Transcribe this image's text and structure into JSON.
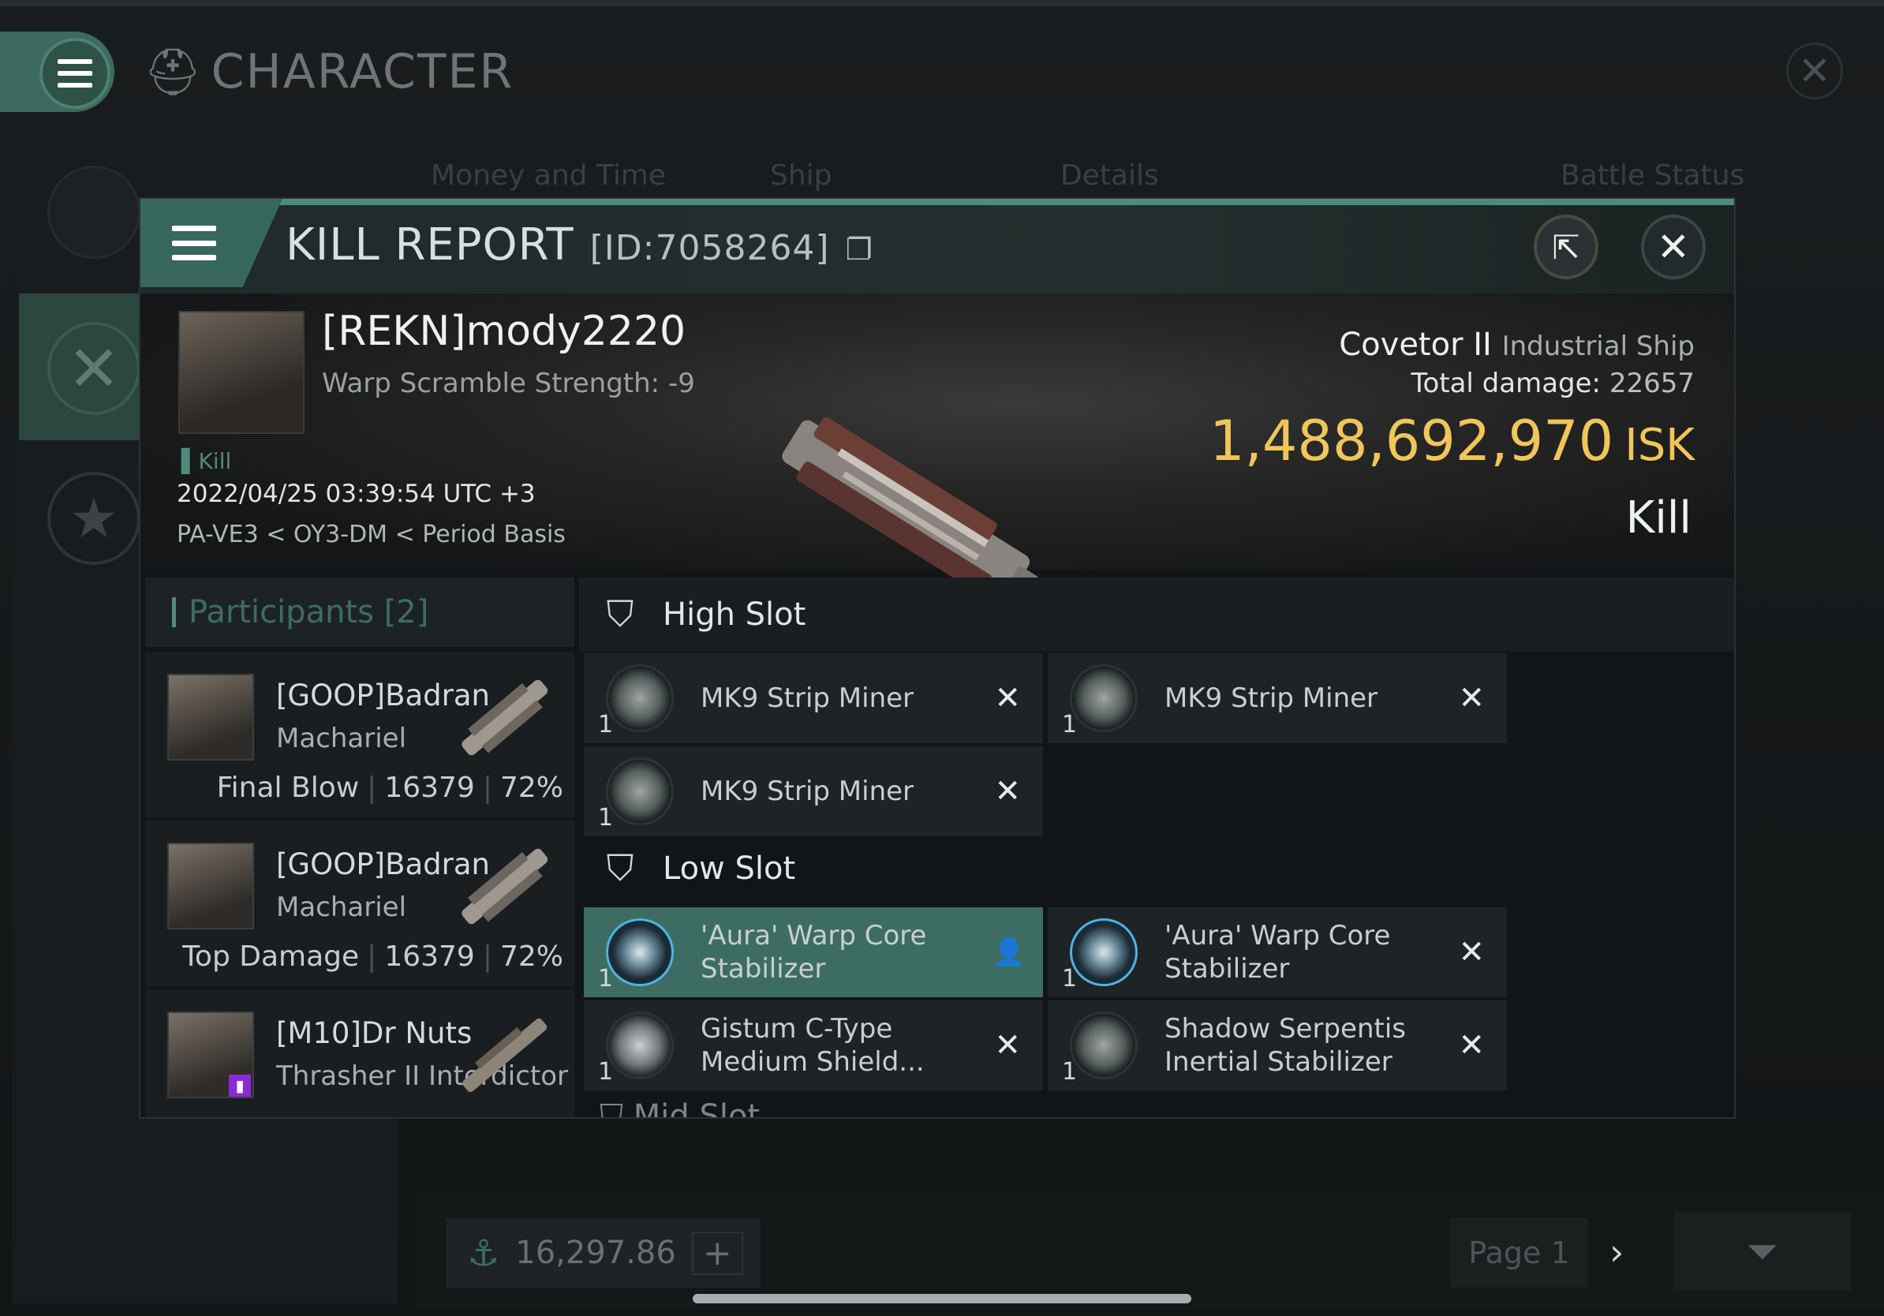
{
  "background": {
    "window_title": "CHARACTER",
    "tabs": [
      "Money and Time",
      "Ship",
      "Details",
      "Battle Status"
    ],
    "wallet_value": "16,297.86",
    "page_label": "Page 1"
  },
  "kill_report": {
    "title": "KILL REPORT",
    "id_label": "[ID:7058264]",
    "victim": {
      "name": "[REKN]mody2220",
      "warp_scramble": "Warp Scramble Strength: -9",
      "kill_tag": "Kill",
      "datetime": "2022/04/25 03:39:54 UTC +3",
      "location": "PA-VE3 < OY3-DM < Period Basis"
    },
    "ship": {
      "name": "Covetor II",
      "class": "Industrial Ship",
      "total_damage_label": "Total damage:",
      "total_damage": "22657",
      "isk_value": "1,488,692,970",
      "isk_unit": "ISK",
      "result": "Kill"
    },
    "participants": {
      "label": "Participants",
      "count": "[2]",
      "rows": [
        {
          "name": "[GOOP]Badran",
          "ship": "Machariel",
          "role": "Final Blow",
          "damage": "16379",
          "percent": "72%"
        },
        {
          "name": "[GOOP]Badran",
          "ship": "Machariel",
          "role": "Top Damage",
          "damage": "16379",
          "percent": "72%"
        },
        {
          "name": "[M10]Dr Nuts",
          "ship": "Thrasher II Interdictor",
          "role": "",
          "damage": "",
          "percent": ""
        }
      ]
    },
    "slots": {
      "high_label": "High Slot",
      "low_label": "Low Slot",
      "partial_label": "Mid Slot",
      "high": [
        {
          "qty": "1",
          "name": "MK9 Strip Miner"
        },
        {
          "qty": "1",
          "name": "MK9 Strip Miner"
        },
        {
          "qty": "1",
          "name": "MK9 Strip Miner"
        }
      ],
      "low": [
        {
          "qty": "1",
          "name": "'Aura' Warp Core Stabilizer"
        },
        {
          "qty": "1",
          "name": "'Aura' Warp Core Stabilizer"
        },
        {
          "qty": "1",
          "name": "Gistum C-Type Medium Shield..."
        },
        {
          "qty": "1",
          "name": "Shadow Serpentis Inertial Stabilizer"
        }
      ]
    }
  },
  "colors": {
    "accent": "#4f8b7b",
    "isk_gold": "#f0c65a",
    "selected_row": "#3d6d62"
  }
}
